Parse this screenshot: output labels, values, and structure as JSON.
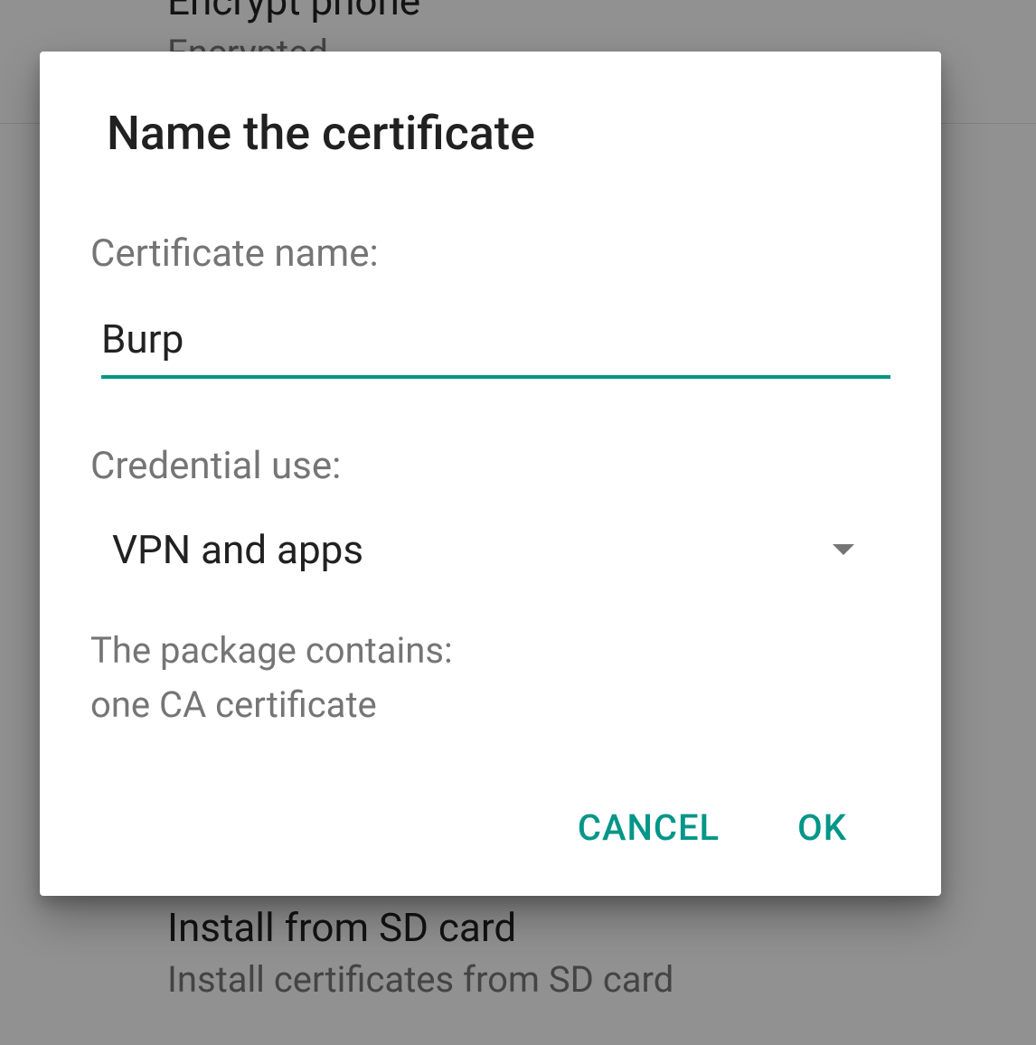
{
  "backdrop": {
    "item_top": {
      "title": "Encrypt phone",
      "subtitle": "Encrypted"
    },
    "item_bottom": {
      "title": "Install from SD card",
      "subtitle": "Install certificates from SD card"
    }
  },
  "dialog": {
    "title": "Name the certificate",
    "cert_name_label": "Certificate name:",
    "cert_name_value": "Burp",
    "credential_use_label": "Credential use:",
    "credential_use_value": "VPN and apps",
    "package_line1": "The package contains:",
    "package_line2": "one CA certificate",
    "cancel_label": "CANCEL",
    "ok_label": "OK"
  },
  "colors": {
    "accent": "#009688"
  }
}
